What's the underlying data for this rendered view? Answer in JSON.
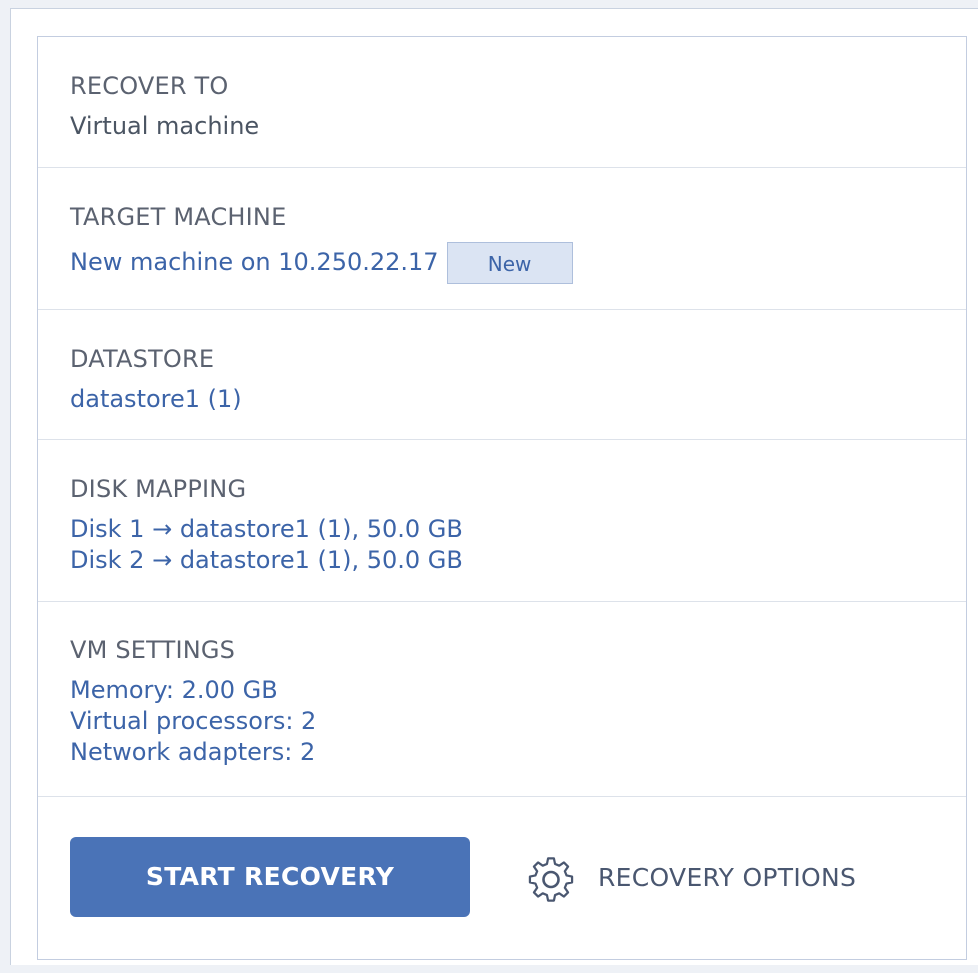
{
  "sections": {
    "recover_to": {
      "label": "RECOVER TO",
      "value": "Virtual machine"
    },
    "target_machine": {
      "label": "TARGET MACHINE",
      "value": "New machine on 10.250.22.17",
      "badge": "New"
    },
    "datastore": {
      "label": "DATASTORE",
      "value": "datastore1 (1)"
    },
    "disk_mapping": {
      "label": "DISK MAPPING",
      "lines": [
        "Disk 1 → datastore1 (1), 50.0 GB",
        "Disk 2 → datastore1 (1), 50.0 GB"
      ]
    },
    "vm_settings": {
      "label": "VM SETTINGS",
      "lines": [
        "Memory: 2.00 GB",
        "Virtual processors: 2",
        "Network adapters: 2"
      ]
    }
  },
  "footer": {
    "start_label": "START RECOVERY",
    "options_label": "RECOVERY OPTIONS",
    "options_icon": "gear-icon"
  },
  "colors": {
    "accent": "#4a73b7",
    "link": "#3c64a8",
    "badge_bg": "#dbe4f3"
  }
}
